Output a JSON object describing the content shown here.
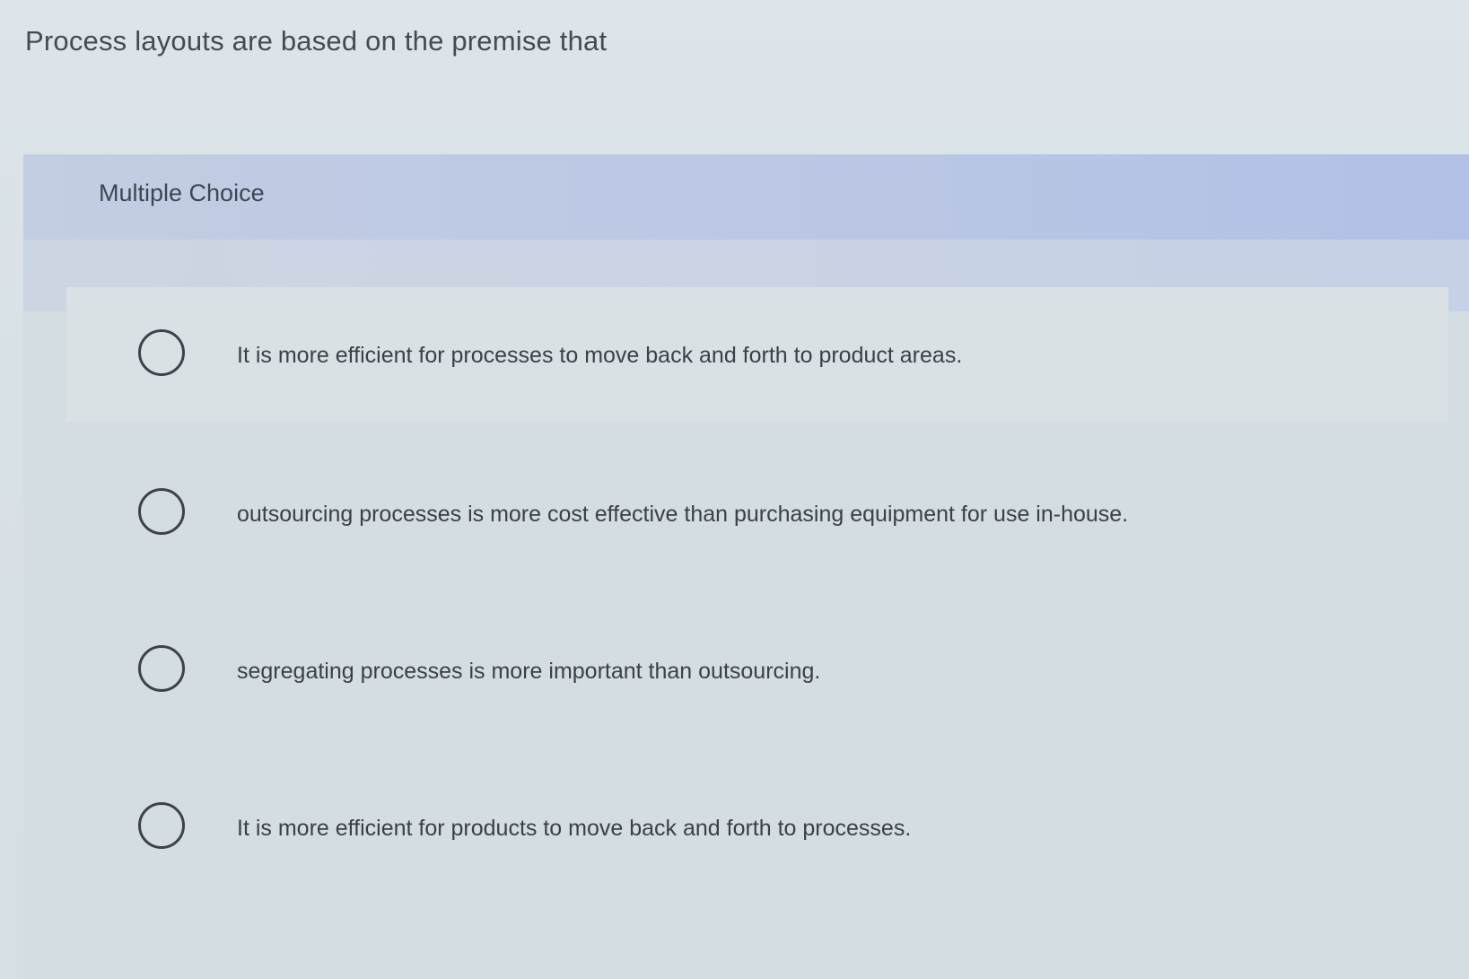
{
  "question": {
    "text": "Process layouts are based on the premise that"
  },
  "card": {
    "header_title": "Multiple Choice",
    "options": [
      {
        "label": "It is more efficient for processes to move back and forth to product areas.",
        "selected": false
      },
      {
        "label": "outsourcing processes is more cost effective than purchasing equipment for use in-house.",
        "selected": false
      },
      {
        "label": "segregating processes is more important than outsourcing.",
        "selected": false
      },
      {
        "label": "It is more efficient for products to move back and forth to processes.",
        "selected": false
      }
    ]
  },
  "colors": {
    "page_background": "#d8e1e6",
    "header_background": "#bac6e4",
    "text": "#3b404a",
    "radio_border": "#3d424c"
  },
  "icons": {
    "radio": "radio-unchecked-icon"
  }
}
